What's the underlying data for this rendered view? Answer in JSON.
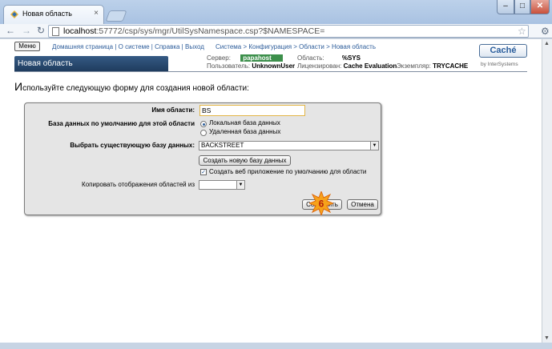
{
  "browser": {
    "tab_title": "Новая область",
    "tab_close": "×",
    "win_min": "–",
    "win_max": "□",
    "win_close": "✕",
    "back": "←",
    "forward": "→",
    "reload": "↻",
    "url_host": "localhost",
    "url_rest": ":57772/csp/sys/mgr/UtilSysNamespace.csp?$NAMESPACE=",
    "bookmark": "☆",
    "wrench": "⚙"
  },
  "header": {
    "menu": "Меню",
    "links": [
      "Домашняя страница",
      "О системе",
      "Справка",
      "Выход"
    ],
    "breadcrumbs": [
      "Система",
      "Конфигурация",
      "Области",
      "Новая область"
    ],
    "caption": "Новая область",
    "server_label": "Сервер:",
    "server_value": "papahost",
    "user_label": "Пользователь:",
    "user_value": "UnknownUser",
    "area_label": "Область:",
    "area_value": "%SYS",
    "licensed_label": "Лицензирован:",
    "licensed_value": "Cache Evaluation",
    "instance_label": "Экземпляр:",
    "instance_value": "TRYCACHE",
    "brand": "Caché",
    "brand_sub": "by InterSystems"
  },
  "instruction_first": "И",
  "instruction_rest": "спользуйте следующую форму для создания новой области:",
  "form": {
    "name_label": "Имя области:",
    "name_value": "BS",
    "default_db_label": "База данных по умолчанию для этой области",
    "radio_local": "Локальная база данных",
    "radio_remote": "Удаленная база данных",
    "choose_db_label": "Выбрать существующую базу данных:",
    "choose_db_value": "BACKSTREET",
    "create_db_button": "Создать новую базу данных",
    "create_web_app_label": "Создать веб приложение по умолчанию для области",
    "copy_mappings_label": "Копировать отображения областей из",
    "copy_mappings_value": "",
    "save_button": "Сохранить",
    "cancel_button": "Отмена"
  },
  "step_badge": "6",
  "colors": {
    "caption_bg": "#1f3c5e",
    "server_bg": "#3c8f4b",
    "link": "#2c5c9a",
    "badge": "#f6a21a"
  }
}
